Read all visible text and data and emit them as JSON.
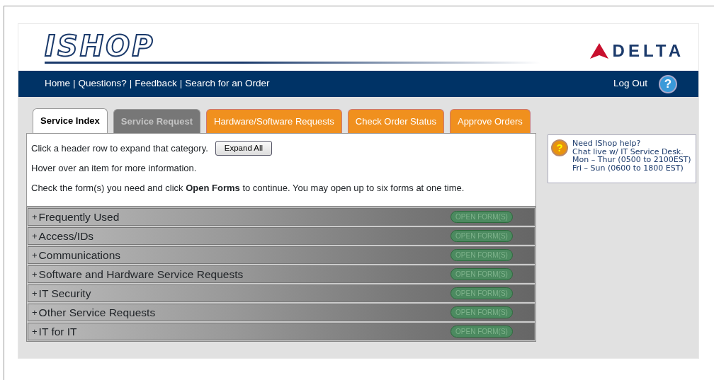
{
  "header": {
    "logo": "ISHOP",
    "brand": "DELTA"
  },
  "nav": {
    "links": [
      "Home",
      "Questions?",
      "Feedback",
      "Search for an Order"
    ],
    "separator": "|",
    "logout": "Log Out",
    "help_glyph": "?"
  },
  "tabs": [
    {
      "label": "Service Index",
      "selected": true,
      "disabled": false
    },
    {
      "label": "Service Request",
      "selected": false,
      "disabled": true
    },
    {
      "label": "Hardware/Software Requests",
      "selected": false,
      "disabled": false
    },
    {
      "label": "Check Order Status",
      "selected": false,
      "disabled": false
    },
    {
      "label": "Approve Orders",
      "selected": false,
      "disabled": false
    }
  ],
  "intro": {
    "line1": "Click a header row to expand that category.",
    "expand_button": "Expand All",
    "line2": "Hover over an item for more information.",
    "line3": "Check the form(s) you need and click **Open Forms** to continue. You may open up to six forms at one time."
  },
  "categories": [
    {
      "toggle": "+",
      "label": "Frequently Used",
      "button": "OPEN FORM(S)",
      "disabled": true
    },
    {
      "toggle": "+",
      "label": "Access/IDs",
      "button": "OPEN FORM(S)",
      "disabled": true
    },
    {
      "toggle": "+",
      "label": "Communications",
      "button": "OPEN FORM(S)",
      "disabled": true
    },
    {
      "toggle": "+",
      "label": "Software and Hardware Service Requests",
      "button": "OPEN FORM(S)",
      "disabled": true
    },
    {
      "toggle": "+",
      "label": "IT Security",
      "button": "OPEN FORM(S)",
      "disabled": true
    },
    {
      "toggle": "+",
      "label": "Other Service Requests",
      "button": "OPEN FORM(S)",
      "disabled": true
    },
    {
      "toggle": "+",
      "label": "IT for IT",
      "button": "OPEN FORM(S)",
      "disabled": true
    }
  ],
  "help_box": {
    "glyph": "?",
    "lines": [
      "Need IShop help?",
      "Chat live w/ IT Service Desk.",
      "Mon – Thur (0500 to 2100EST)",
      "Fri – Sun (0600 to 1800 EST)"
    ]
  }
}
